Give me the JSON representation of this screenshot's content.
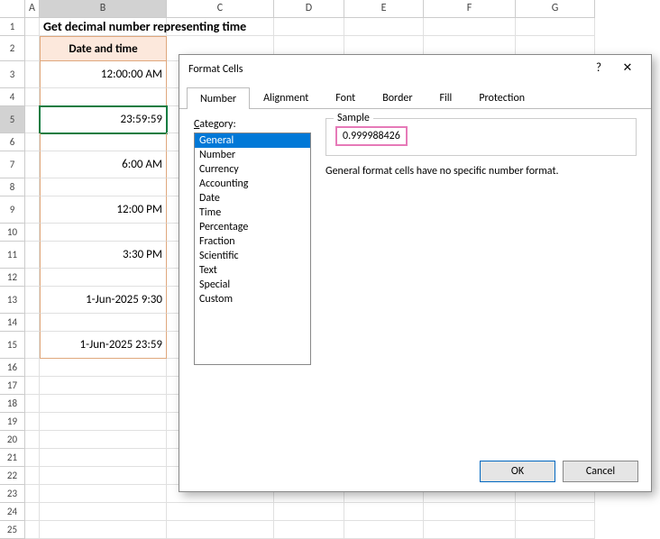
{
  "title": "Get decimal number representing time",
  "columns": [
    "A",
    "B",
    "C",
    "D",
    "E",
    "F",
    "G"
  ],
  "active_col": "B",
  "active_row": 5,
  "rows_count": 25,
  "tall_rows": [
    3,
    5,
    7,
    9,
    11,
    13,
    15
  ],
  "table_header": "Date and time",
  "data": {
    "3": "12:00:00 AM",
    "5": "23:59:59",
    "7": "6:00 AM",
    "9": "12:00 PM",
    "11": "3:30 PM",
    "13": "1-Jun-2025 9:30",
    "15": "1-Jun-2025 23:59"
  },
  "dialog": {
    "title": "Format Cells",
    "help": "?",
    "close": "✕",
    "tabs": [
      "Number",
      "Alignment",
      "Font",
      "Border",
      "Fill",
      "Protection"
    ],
    "active_tab": "Number",
    "category_label": "Category:",
    "categories": [
      "General",
      "Number",
      "Currency",
      "Accounting",
      "Date",
      "Time",
      "Percentage",
      "Fraction",
      "Scientific",
      "Text",
      "Special",
      "Custom"
    ],
    "selected_category": "General",
    "sample_label": "Sample",
    "sample_value": "0.999988426",
    "description": "General format cells have no specific number format.",
    "ok": "OK",
    "cancel": "Cancel"
  }
}
